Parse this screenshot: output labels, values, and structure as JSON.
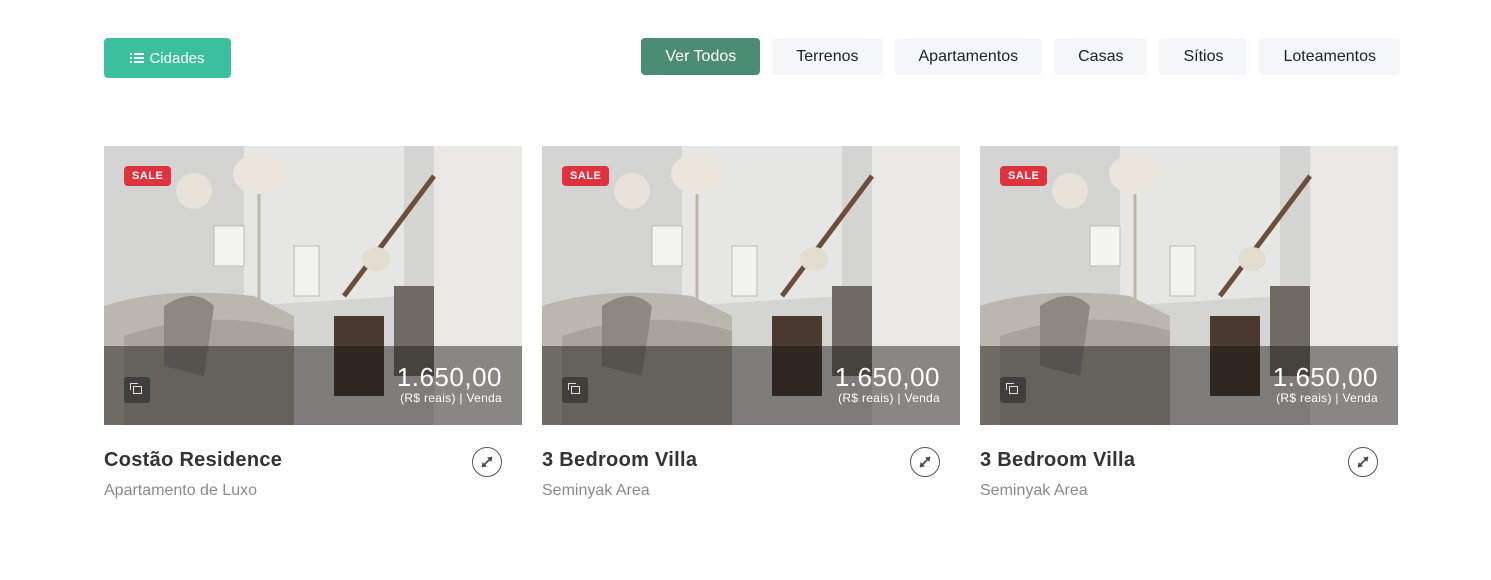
{
  "toolbar": {
    "cities_label": "Cidades",
    "filters": [
      {
        "label": "Ver Todos",
        "active": true
      },
      {
        "label": "Terrenos",
        "active": false
      },
      {
        "label": "Apartamentos",
        "active": false
      },
      {
        "label": "Casas",
        "active": false
      },
      {
        "label": "Sítios",
        "active": false
      },
      {
        "label": "Loteamentos",
        "active": false
      }
    ]
  },
  "listings": [
    {
      "badge": "SALE",
      "price": "1.650,00",
      "price_detail": "(R$ reais) | Venda",
      "title": "Costão Residence",
      "subtitle": "Apartamento de Luxo"
    },
    {
      "badge": "SALE",
      "price": "1.650,00",
      "price_detail": "(R$ reais) | Venda",
      "title": "3 Bedroom Villa",
      "subtitle": "Seminyak Area"
    },
    {
      "badge": "SALE",
      "price": "1.650,00",
      "price_detail": "(R$ reais) | Venda",
      "title": "3 Bedroom Villa",
      "subtitle": "Seminyak Area"
    }
  ],
  "icons": {
    "cities": "list-icon",
    "gallery": "gallery-icon",
    "expand": "expand-icon"
  },
  "colors": {
    "accent": "#3cbf9e",
    "active_filter": "#4a8d72",
    "sale_badge": "#e0313f"
  }
}
